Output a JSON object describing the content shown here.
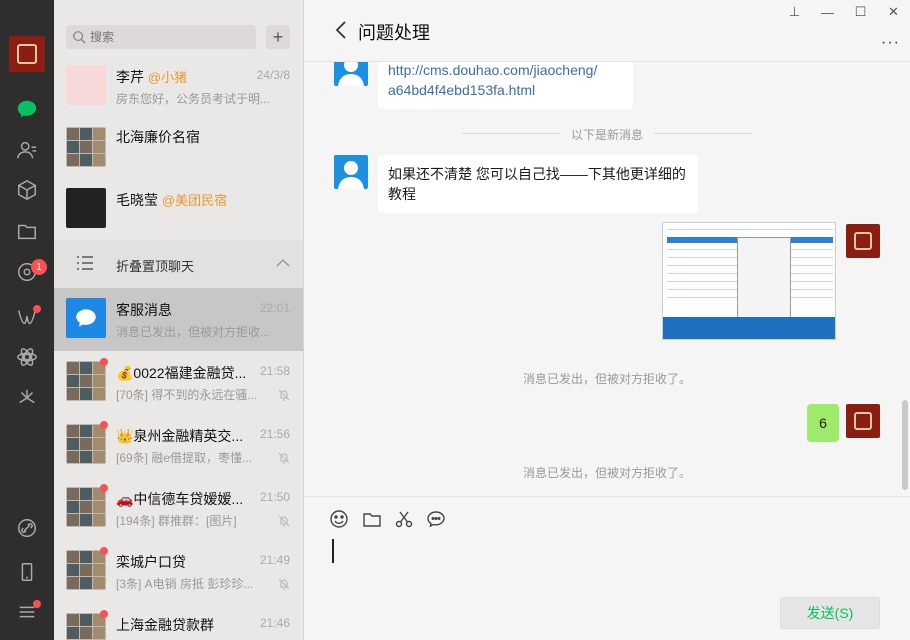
{
  "sidebar": {
    "moments_badge": "1"
  },
  "search": {
    "placeholder": "搜索"
  },
  "list": {
    "add_label": "+",
    "items": [
      {
        "name": "李芹",
        "tag": "@小猪",
        "time": "24/3/8",
        "preview": "房东您好，公务员考试于明..."
      },
      {
        "name": "北海廉价名宿",
        "tag": "",
        "time": "",
        "preview": ""
      },
      {
        "name": "毛晓莹",
        "tag": "@美团民宿",
        "time": "",
        "preview": ""
      }
    ],
    "fold_label": "折叠置顶聊天",
    "items2": [
      {
        "name": "客服消息",
        "time": "22:01",
        "preview": "消息已发出，但被对方拒收..."
      },
      {
        "name": "💰0022福建金融贷...",
        "time": "21:58",
        "preview": "[70条] 得不到的永远在骚..."
      },
      {
        "name": "👑泉州金融精英交...",
        "time": "21:56",
        "preview": "[69条] 融e借提取，枣懂..."
      },
      {
        "name": "🚗中信德车贷嫒嫒...",
        "time": "21:50",
        "preview": "[194条] 群推群：[图片]"
      },
      {
        "name": "栾城户口贷",
        "time": "21:49",
        "preview": "[3条] A电销  房抵 彭珍珍..."
      },
      {
        "name": "上海金融贷款群",
        "time": "21:46",
        "preview": ""
      }
    ]
  },
  "conversation": {
    "title": "问题处理",
    "more": "···",
    "window": {
      "pin": "⊥",
      "min": "—",
      "max": "☐",
      "close": "✕"
    },
    "msg_link_line1": "http://cms.douhao.com/jiaocheng/",
    "msg_link_line2": "a64bd4f4ebd153fa.html",
    "new_divider": "以下是新消息",
    "msg_text_line1": "如果还不清楚 您可以自己找——下其他更详细的",
    "msg_text_line2": "教程",
    "rejected_1": "消息已发出，但被对方拒收了。",
    "self_msg": "6",
    "rejected_2": "消息已发出，但被对方拒收了。"
  },
  "input": {
    "send_label": "发送(S)"
  },
  "colors": {
    "accent": "#07c160",
    "badge": "#fa5151",
    "self_bubble": "#9eea6a"
  }
}
